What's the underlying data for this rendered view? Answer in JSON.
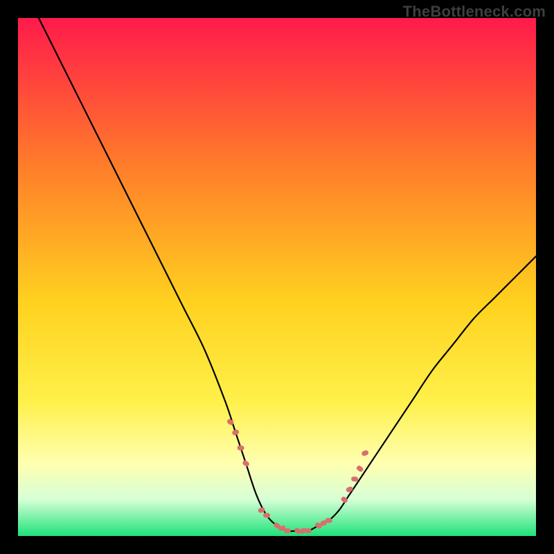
{
  "watermark": "TheBottleneck.com",
  "colors": {
    "gradient_top": "#ff1a4b",
    "gradient_upper_mid": "#ff7b2a",
    "gradient_mid": "#ffd21f",
    "gradient_lower_mid": "#fff04a",
    "gradient_pale_yellow": "#ffffb0",
    "gradient_pale_green": "#d6ffd6",
    "gradient_bottom": "#1ee27a",
    "frame": "#000000",
    "curve": "#000000",
    "marker": "#d86f6a"
  },
  "chart_data": {
    "type": "line",
    "title": "",
    "xlabel": "",
    "ylabel": "",
    "xlim": [
      0,
      100
    ],
    "ylim": [
      0,
      100
    ],
    "grid": false,
    "legend": false,
    "series": [
      {
        "name": "bottleneck_curve",
        "x": [
          4,
          8,
          12,
          16,
          20,
          24,
          28,
          32,
          36,
          40,
          42,
          44,
          46,
          48,
          50,
          52,
          54,
          56,
          58,
          60,
          62,
          64,
          68,
          72,
          76,
          80,
          84,
          88,
          92,
          96,
          100
        ],
        "y": [
          100,
          92,
          84,
          76,
          68,
          60,
          52,
          44,
          36,
          26,
          20,
          14,
          8,
          4,
          2,
          1,
          1,
          1,
          2,
          3,
          5,
          8,
          14,
          20,
          26,
          32,
          37,
          42,
          46,
          50,
          54
        ]
      }
    ],
    "markers": {
      "name": "highlight_points",
      "x": [
        41,
        42,
        43,
        44,
        47,
        48,
        50,
        51,
        52,
        54,
        55,
        56,
        58,
        59,
        60,
        63,
        64,
        65,
        66,
        67
      ],
      "y": [
        22,
        20,
        17,
        14,
        5,
        4,
        2,
        1.5,
        1,
        1,
        1,
        1,
        2,
        2.5,
        3,
        7,
        9,
        11,
        13,
        16
      ]
    }
  }
}
